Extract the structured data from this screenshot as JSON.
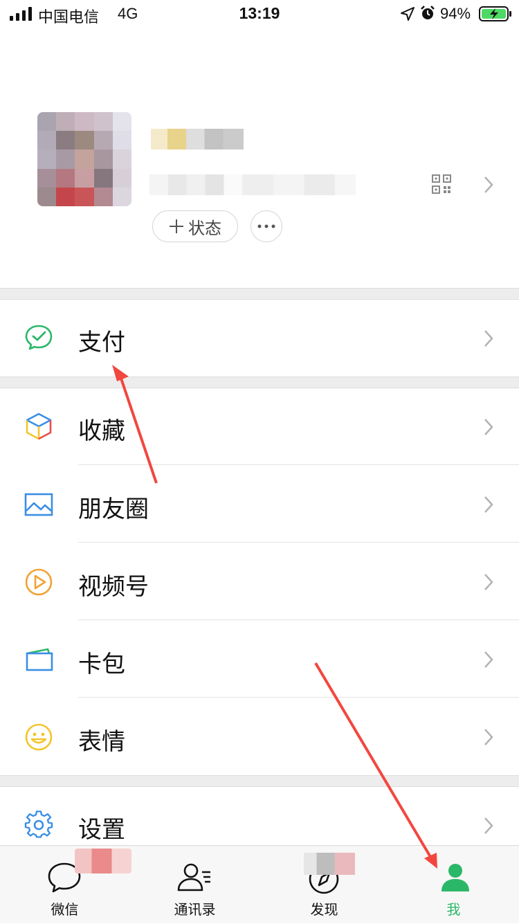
{
  "status_bar": {
    "carrier": "中国电信",
    "network": "4G",
    "time": "13:19",
    "battery_percent": "94%",
    "icons": [
      "signal-icon",
      "location-icon",
      "alarm-icon",
      "battery-charging-icon"
    ]
  },
  "profile": {
    "status_button_label": "状态",
    "icons": [
      "qr-code-icon",
      "chevron-right-icon",
      "plus-icon",
      "more-icon"
    ]
  },
  "menu": {
    "pay": {
      "label": "支付",
      "icon": "wechat-pay-icon"
    },
    "favorites": {
      "label": "收藏",
      "icon": "cube-icon"
    },
    "moments": {
      "label": "朋友圈",
      "icon": "image-icon"
    },
    "channels": {
      "label": "视频号",
      "icon": "play-circle-icon"
    },
    "cards": {
      "label": "卡包",
      "icon": "wallet-icon"
    },
    "stickers": {
      "label": "表情",
      "icon": "smile-icon"
    },
    "settings": {
      "label": "设置",
      "icon": "gear-icon"
    }
  },
  "tab_bar": {
    "tabs": [
      {
        "label": "微信",
        "icon": "chat-bubble-icon",
        "active": false
      },
      {
        "label": "通讯录",
        "icon": "contacts-icon",
        "active": false
      },
      {
        "label": "发现",
        "icon": "compass-icon",
        "active": false
      },
      {
        "label": "我",
        "icon": "person-icon",
        "active": true
      }
    ]
  },
  "colors": {
    "brand_green": "#07c160",
    "background_gray": "#ededed",
    "annotation_red": "#f2473f",
    "pay_icon": "#2bb768",
    "moments_icon": "#3a8ee6",
    "channels_icon": "#f0a234",
    "cards_icon": "#3a8ee6",
    "stickers_icon": "#f2c52c",
    "settings_icon": "#3a8ee6"
  }
}
